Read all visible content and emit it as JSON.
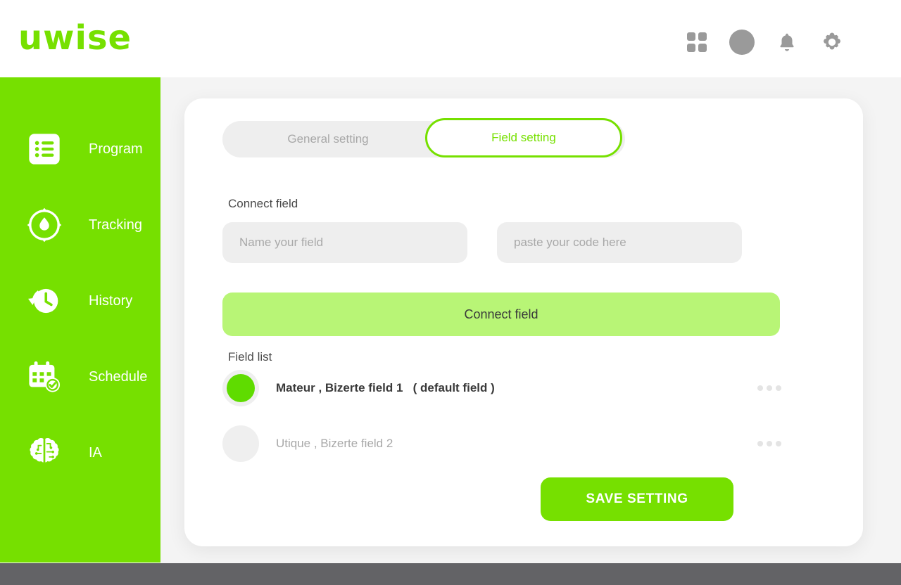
{
  "header": {
    "logo_text": "uwise",
    "icons": [
      {
        "name": "grid-icon",
        "label": "Apps"
      },
      {
        "name": "avatar-icon",
        "label": "Account"
      },
      {
        "name": "bell-icon",
        "label": "Notifications"
      },
      {
        "name": "gear-icon",
        "label": "Settings"
      }
    ]
  },
  "sidebar": {
    "items": [
      {
        "label": "Program",
        "icon": "list-icon"
      },
      {
        "label": "Tracking",
        "icon": "water-drop-cycle-icon"
      },
      {
        "label": "History",
        "icon": "clock-back-icon"
      },
      {
        "label": "Schedule",
        "icon": "calendar-check-icon"
      },
      {
        "label": "IA",
        "icon": "brain-circuit-icon"
      }
    ]
  },
  "main": {
    "tabs": [
      {
        "label": "General setting",
        "active": false
      },
      {
        "label": "Field setting",
        "active": true
      }
    ],
    "connect_section": {
      "label": "Connect field",
      "name_input": {
        "value": "",
        "placeholder": "Name your field"
      },
      "code_input": {
        "value": "",
        "placeholder": "paste your code here"
      },
      "button_label": "Connect field"
    },
    "field_list": {
      "label": "Field list",
      "rows": [
        {
          "text": "Mateur , Bizerte field 1   ( default field )",
          "selected": true,
          "menu": "more-options"
        },
        {
          "text": "Utique , Bizerte field 2",
          "selected": false,
          "menu": "more-options"
        }
      ]
    },
    "save_label": "SAVE SETTING"
  },
  "colors": {
    "brand_green": "#76e000",
    "light_green": "#b8f576",
    "radio_green": "#5fdc00",
    "bottom_bar": "#636366",
    "page_bg": "#f4f4f4"
  }
}
